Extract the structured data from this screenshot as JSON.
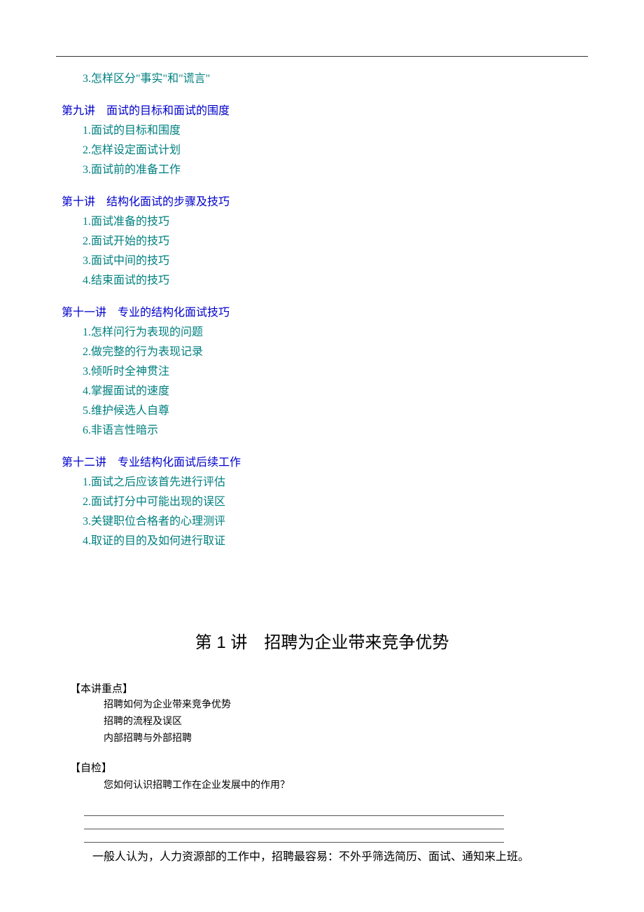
{
  "toc": {
    "orphan_item": "3.怎样区分\"事实\"和\"谎言\"",
    "sections": [
      {
        "title": "第九讲　面试的目标和面试的围度",
        "items": [
          "1.面试的目标和围度",
          "2.怎样设定面试计划",
          "3.面试前的准备工作"
        ]
      },
      {
        "title": "第十讲　结构化面试的步骤及技巧",
        "items": [
          "1.面试准备的技巧",
          "2.面试开始的技巧",
          "3.面试中间的技巧",
          "4.结束面试的技巧"
        ]
      },
      {
        "title": "第十一讲　专业的结构化面试技巧",
        "items": [
          "1.怎样问行为表现的问题",
          "2.做完整的行为表现记录",
          "3.倾听时全神贯注",
          "4.掌握面试的速度",
          "5.维护候选人自尊",
          "6.非语言性暗示"
        ]
      },
      {
        "title": "第十二讲　专业结构化面试后续工作",
        "items": [
          "1.面试之后应该首先进行评估",
          "2.面试打分中可能出现的误区",
          "3.关键职位合格者的心理测评",
          "4.取证的目的及如何进行取证"
        ]
      }
    ]
  },
  "chapter": {
    "title": "第 1 讲　招聘为企业带来竞争优势",
    "focus_label": "【本讲重点】",
    "focus_items": [
      "招聘如何为企业带来竞争优势",
      "招聘的流程及误区",
      "内部招聘与外部招聘"
    ],
    "selfcheck_label": "【自检】",
    "selfcheck_question": "您如何认识招聘工作在企业发展中的作用？",
    "body_para": "一般人认为，人力资源部的工作中，招聘最容易：不外乎筛选简历、面试、通知来上班。"
  }
}
